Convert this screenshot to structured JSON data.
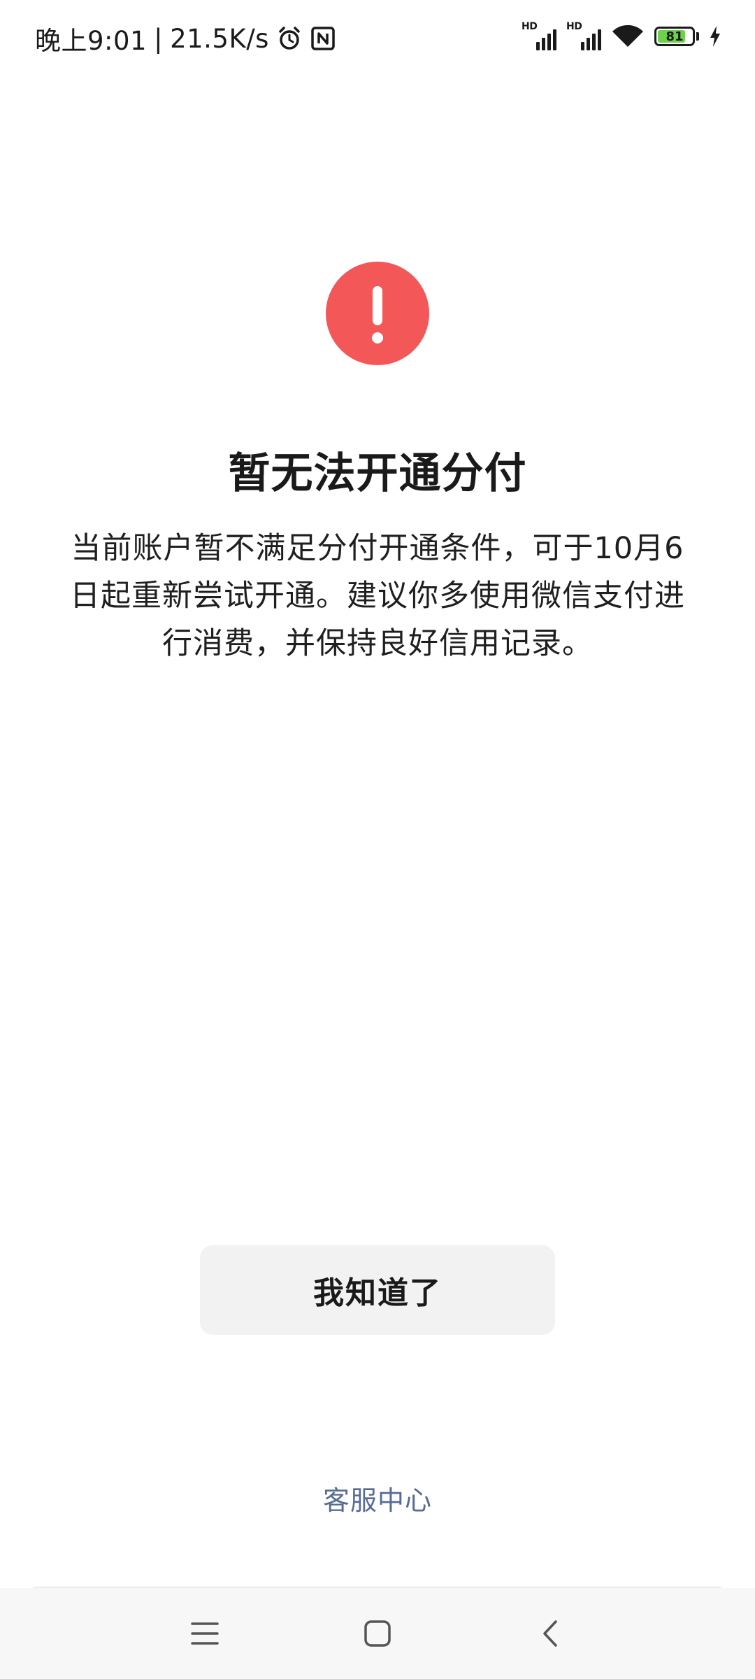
{
  "status_bar": {
    "time": "晚上9:01",
    "separator": "|",
    "network_speed": "21.5K/s",
    "icons": [
      "alarm-icon",
      "nfc-icon",
      "signal-hd-icon",
      "signal-hd-icon",
      "wifi-icon",
      "battery-icon",
      "charging-icon"
    ],
    "signal_hd_label": "HD",
    "battery_level": "81",
    "battery_fraction": 0.81
  },
  "alert": {
    "icon": "exclamation-circle-icon",
    "color": "#f35757"
  },
  "title": "暂无法开通分付",
  "description": "当前账户暂不满足分付开通条件，可于10月6日起重新尝试开通。建议你多使用微信支付进行消费，并保持良好信用记录。",
  "actions": {
    "acknowledge_label": "我知道了",
    "customer_service_label": "客服中心"
  },
  "colors": {
    "link": "#576b95",
    "button_bg": "#f2f2f2"
  },
  "nav_bar": {
    "buttons": [
      "menu-icon",
      "home-icon",
      "back-icon"
    ]
  }
}
